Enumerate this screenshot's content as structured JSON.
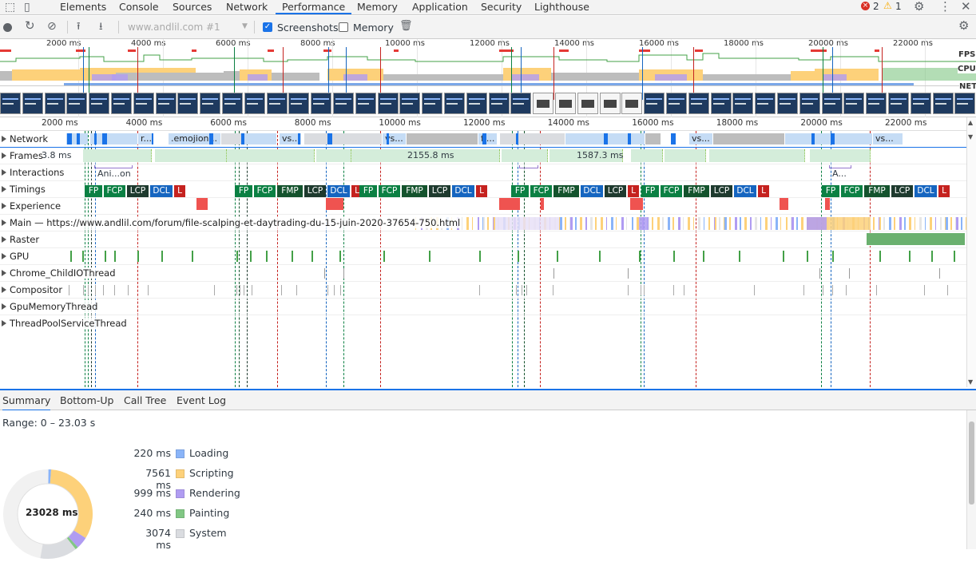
{
  "tabs": [
    "Elements",
    "Console",
    "Sources",
    "Network",
    "Performance",
    "Memory",
    "Application",
    "Security",
    "Lighthouse"
  ],
  "active_tab": "Performance",
  "badges": {
    "errors": "2",
    "warnings": "1"
  },
  "toolbar": {
    "url_select": "www.andlil.com #1",
    "screenshots_label": "Screenshots",
    "memory_label": "Memory",
    "screenshots_checked": true,
    "memory_checked": false
  },
  "overview": {
    "ruler": [
      "2000 ms",
      "4000 ms",
      "6000 ms",
      "8000 ms",
      "10000 ms",
      "12000 ms",
      "14000 ms",
      "16000 ms",
      "18000 ms",
      "20000 ms",
      "22000 ms"
    ],
    "track_labels": [
      "FPS",
      "CPU",
      "NET"
    ]
  },
  "flame_ruler": [
    "2000 ms",
    "4000 ms",
    "6000 ms",
    "8000 ms",
    "10000 ms",
    "12000 ms",
    "14000 ms",
    "16000 ms",
    "18000 ms",
    "20000 ms",
    "22000 ms"
  ],
  "rows": {
    "network": "Network",
    "frames": "Frames",
    "interactions": "Interactions",
    "timings": "Timings",
    "experience": "Experience",
    "main": "Main — https://www.andlil.com/forum/file-scalping-et-daytrading-du-15-juin-2020-37654-750.html",
    "raster": "Raster",
    "gpu": "GPU",
    "child_io": "Chrome_ChildIOThread",
    "compositor": "Compositor",
    "gpu_memory": "GpuMemoryThread",
    "threadpool": "ThreadPoolServiceThread"
  },
  "network_items": [
    "r...",
    ".emojion...",
    "vs...",
    "vs...",
    "fi...",
    "vs...",
    "vs..."
  ],
  "frames_items": [
    "3.8 ms",
    "2155.8 ms",
    "1587.3 ms"
  ],
  "interaction_items": [
    "Ani...on",
    "A..."
  ],
  "timings": [
    {
      "label": "FP",
      "color": "#0b8043"
    },
    {
      "label": "FCP",
      "color": "#0b8043"
    },
    {
      "label": "LCP",
      "color": "#1e3a2e"
    },
    {
      "label": "DCL",
      "color": "#1565c0"
    },
    {
      "label": "L",
      "color": "#c5221f"
    },
    {
      "label": "FP",
      "color": "#0b8043"
    },
    {
      "label": "FCP",
      "color": "#0b8043"
    },
    {
      "label": "FMP",
      "color": "#14532d"
    },
    {
      "label": "LCP",
      "color": "#1e3a2e"
    },
    {
      "label": "DCL",
      "color": "#1565c0"
    },
    {
      "label": "L",
      "color": "#c5221f"
    },
    {
      "label": "FP",
      "color": "#0b8043"
    },
    {
      "label": "FCP",
      "color": "#0b8043"
    },
    {
      "label": "FMP",
      "color": "#14532d"
    },
    {
      "label": "LCP",
      "color": "#1e3a2e"
    },
    {
      "label": "DCL",
      "color": "#1565c0"
    },
    {
      "label": "L",
      "color": "#c5221f"
    },
    {
      "label": "FP",
      "color": "#0b8043"
    },
    {
      "label": "FCP",
      "color": "#0b8043"
    },
    {
      "label": "FMP",
      "color": "#14532d"
    },
    {
      "label": "DCL",
      "color": "#1565c0"
    },
    {
      "label": "LCP",
      "color": "#1e3a2e"
    },
    {
      "label": "L",
      "color": "#c5221f"
    },
    {
      "label": "FP",
      "color": "#0b8043"
    },
    {
      "label": "FCP",
      "color": "#0b8043"
    },
    {
      "label": "FMP",
      "color": "#14532d"
    },
    {
      "label": "LCP",
      "color": "#1e3a2e"
    },
    {
      "label": "DCL",
      "color": "#1565c0"
    },
    {
      "label": "L",
      "color": "#c5221f"
    },
    {
      "label": "FP",
      "color": "#0b8043"
    },
    {
      "label": "FCP",
      "color": "#0b8043"
    },
    {
      "label": "FMP",
      "color": "#14532d"
    },
    {
      "label": "LCP",
      "color": "#1e3a2e"
    },
    {
      "label": "DCL",
      "color": "#1565c0"
    },
    {
      "label": "L",
      "color": "#c5221f"
    }
  ],
  "bottom_tabs": [
    "Summary",
    "Bottom-Up",
    "Call Tree",
    "Event Log"
  ],
  "summary": {
    "range": "Range: 0 – 23.03 s",
    "total": "23028 ms",
    "items": [
      {
        "value": "220 ms",
        "name": "Loading",
        "color": "#8ab4f8",
        "ms": 220
      },
      {
        "value": "7561 ms",
        "name": "Scripting",
        "color": "#fdd17a",
        "ms": 7561
      },
      {
        "value": "999 ms",
        "name": "Rendering",
        "color": "#b09cf2",
        "ms": 999
      },
      {
        "value": "240 ms",
        "name": "Painting",
        "color": "#81c784",
        "ms": 240
      },
      {
        "value": "3074 ms",
        "name": "System",
        "color": "#dadce0",
        "ms": 3074
      }
    ],
    "idle_color": "#ffffff"
  }
}
